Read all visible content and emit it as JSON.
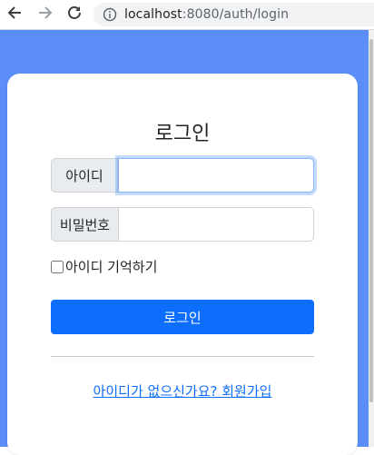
{
  "browser": {
    "url_host": "localhost",
    "url_port_path": ":8080/auth/login"
  },
  "login": {
    "title": "로그인",
    "id_label": "아이디",
    "id_value": "",
    "password_label": "비밀번호",
    "password_value": "",
    "remember_label": "아이디 기억하기",
    "remember_checked": false,
    "submit_label": "로그인",
    "signup_link": "아이디가 없으신가요? 회원가입"
  },
  "colors": {
    "page_background": "#5b8ef7",
    "primary": "#0d6efd"
  }
}
